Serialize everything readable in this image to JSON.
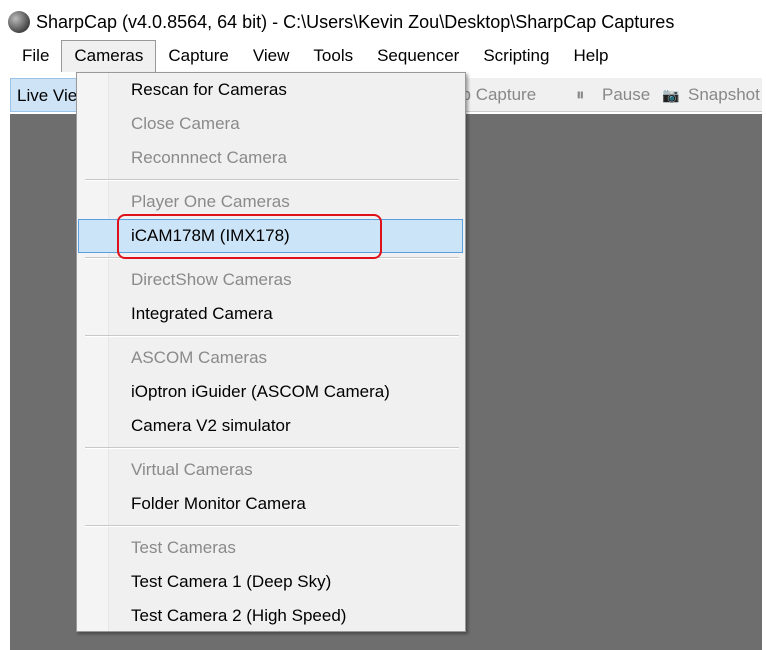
{
  "window": {
    "title": "SharpCap (v4.0.8564, 64 bit) - C:\\Users\\Kevin Zou\\Desktop\\SharpCap Captures"
  },
  "menubar": [
    "File",
    "Cameras",
    "Capture",
    "View",
    "Tools",
    "Sequencer",
    "Scripting",
    "Help"
  ],
  "toolbar": {
    "live_view": "Live View",
    "stop_capture": "Stop Capture",
    "pause": "Pause",
    "snapshot": "Snapshot"
  },
  "menu": [
    {
      "type": "item",
      "label": "Rescan for Cameras"
    },
    {
      "type": "disabled",
      "label": "Close Camera"
    },
    {
      "type": "disabled",
      "label": "Reconnnect Camera"
    },
    {
      "type": "sep"
    },
    {
      "type": "disabled",
      "label": "Player One Cameras"
    },
    {
      "type": "selected",
      "label": "iCAM178M (IMX178)"
    },
    {
      "type": "sep"
    },
    {
      "type": "disabled",
      "label": "DirectShow Cameras"
    },
    {
      "type": "item",
      "label": "Integrated Camera"
    },
    {
      "type": "sep"
    },
    {
      "type": "disabled",
      "label": "ASCOM Cameras"
    },
    {
      "type": "item",
      "label": "iOptron iGuider (ASCOM Camera)"
    },
    {
      "type": "item",
      "label": "Camera V2 simulator"
    },
    {
      "type": "sep"
    },
    {
      "type": "disabled",
      "label": "Virtual Cameras"
    },
    {
      "type": "item",
      "label": "Folder Monitor Camera"
    },
    {
      "type": "sep"
    },
    {
      "type": "disabled",
      "label": "Test Cameras"
    },
    {
      "type": "item",
      "label": "Test Camera 1 (Deep Sky)"
    },
    {
      "type": "item",
      "label": "Test Camera 2 (High Speed)"
    }
  ],
  "colors": {
    "highlight": "#cce4f7",
    "annotation": "#e0101a"
  }
}
